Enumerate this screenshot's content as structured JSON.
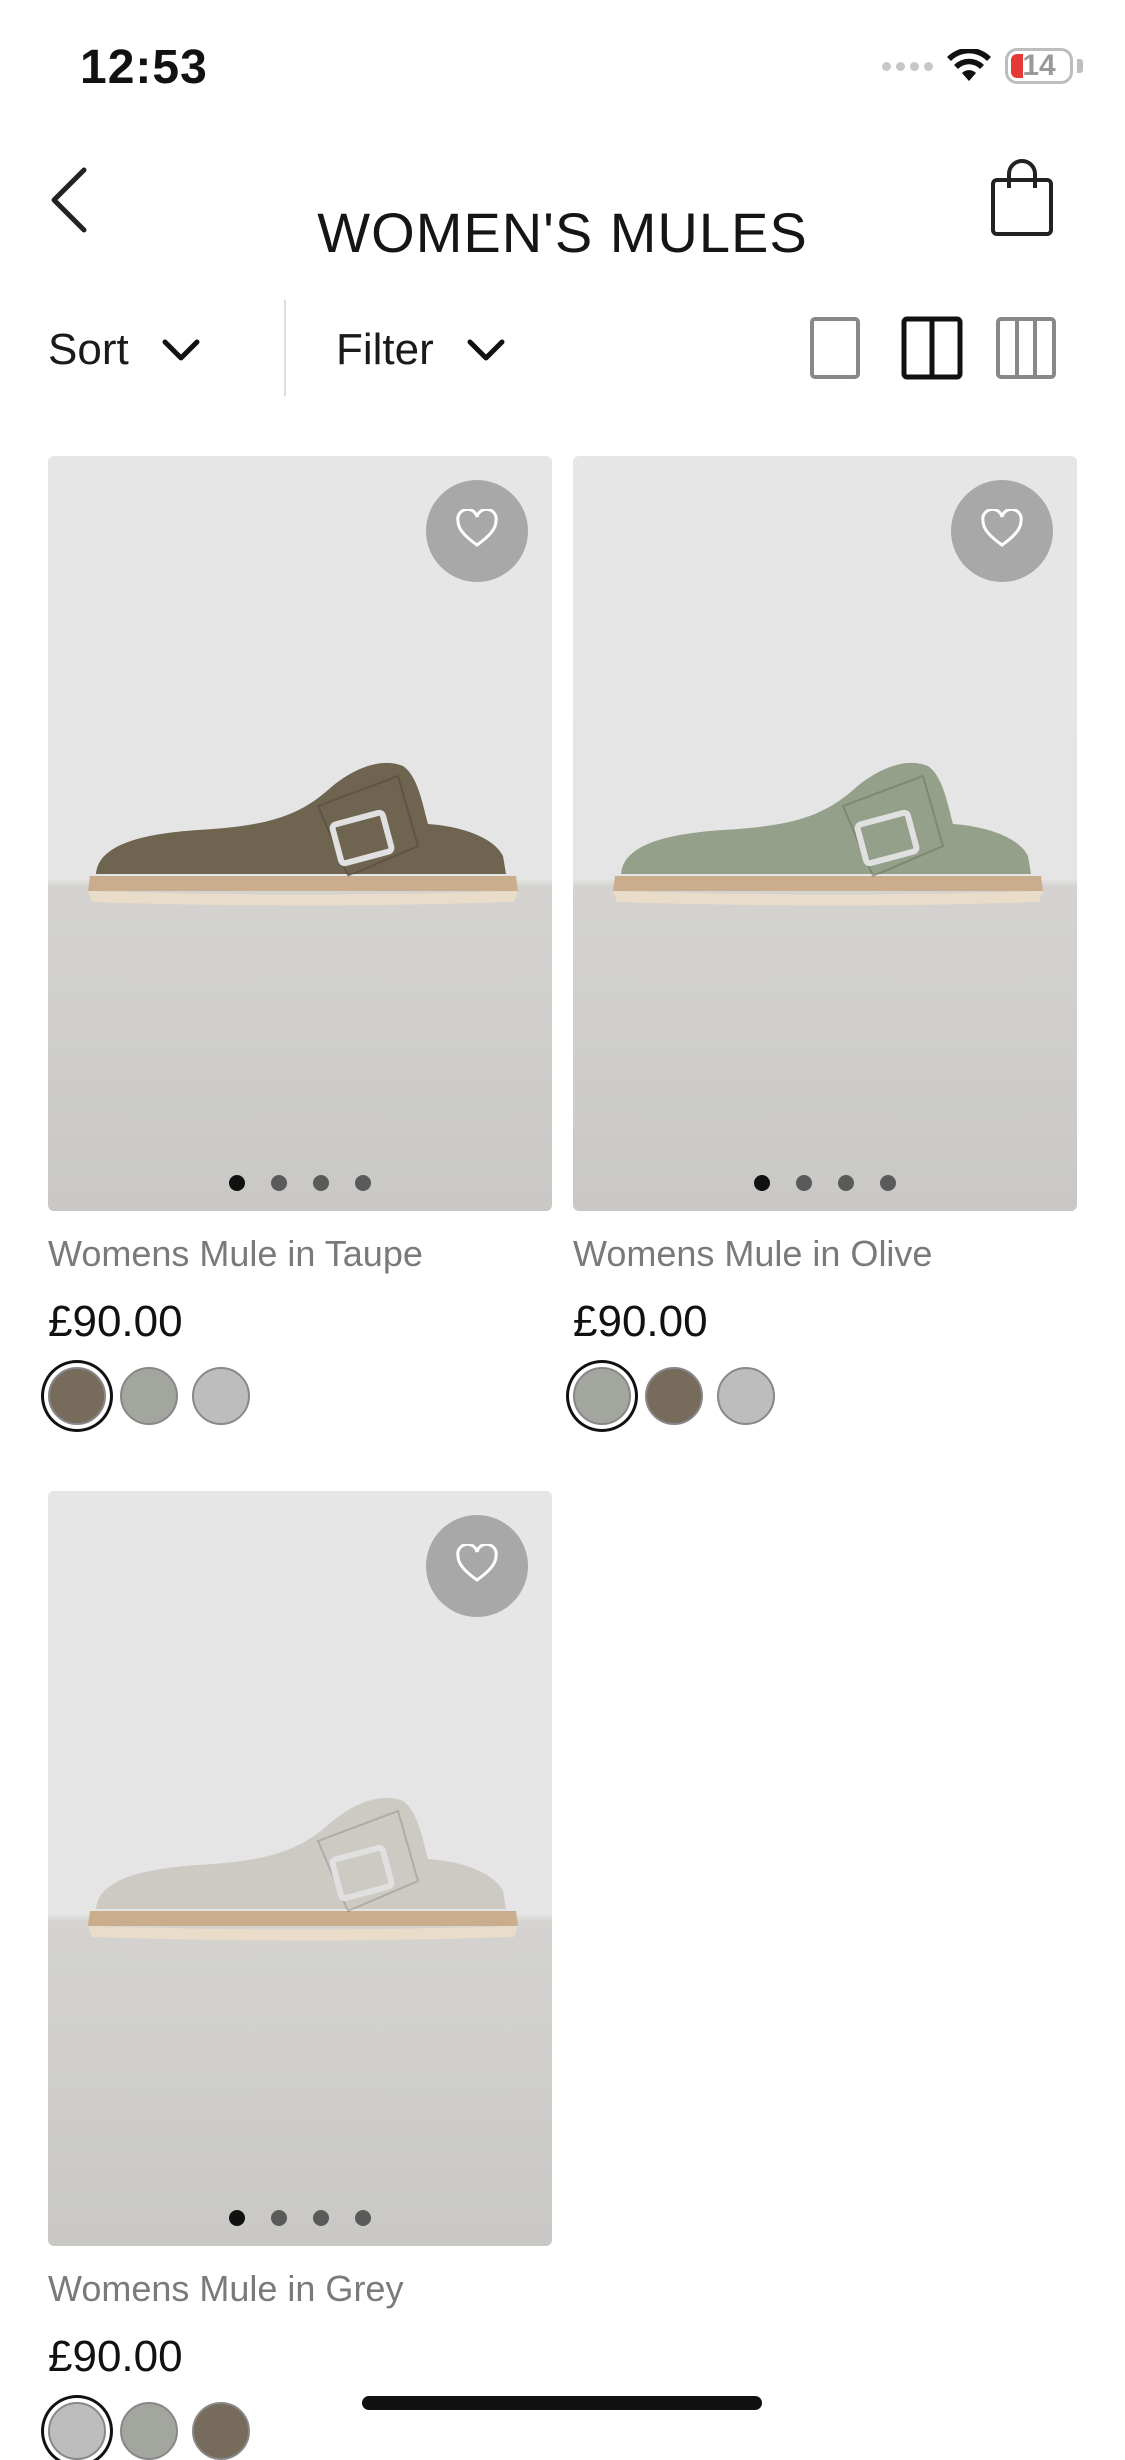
{
  "status": {
    "time": "12:53",
    "battery": "14"
  },
  "header": {
    "title": "WOMEN'S MULES"
  },
  "controls": {
    "sort_label": "Sort",
    "filter_label": "Filter"
  },
  "products": [
    {
      "name": "Womens Mule in Taupe",
      "price": "£90.00",
      "shoe_color": "#6f6450",
      "swatches": [
        "#776b5c",
        "#a3a59f",
        "#bdbdbd"
      ],
      "selected_swatch": 0,
      "image_dots": 4,
      "active_dot": 0
    },
    {
      "name": "Womens Mule in Olive",
      "price": "£90.00",
      "shoe_color": "#94a08a",
      "swatches": [
        "#a3a59f",
        "#776b5c",
        "#bdbdbd"
      ],
      "selected_swatch": 0,
      "image_dots": 4,
      "active_dot": 0
    },
    {
      "name": "Womens Mule in Grey",
      "price": "£90.00",
      "shoe_color": "#cdcac4",
      "swatches": [
        "#bdbdbd",
        "#a3a59f",
        "#776b5c"
      ],
      "selected_swatch": 0,
      "image_dots": 4,
      "active_dot": 0
    }
  ]
}
